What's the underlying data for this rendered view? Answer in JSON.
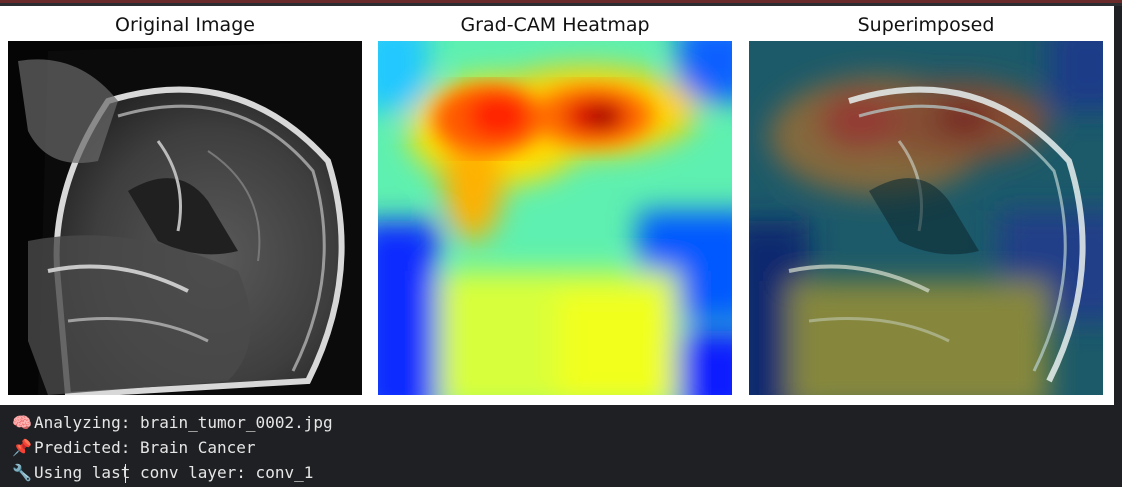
{
  "figure": {
    "titles": [
      "Original Image",
      "Grad-CAM Heatmap",
      "Superimposed"
    ]
  },
  "output": {
    "lines": [
      {
        "icon": "brain-icon",
        "glyph": "🧠",
        "text": "Analyzing: brain_tumor_0002.jpg"
      },
      {
        "icon": "pushpin-icon",
        "glyph": "📌",
        "text": "Predicted: Brain Cancer"
      },
      {
        "icon": "wrench-icon",
        "glyph": "🔧",
        "text": "Using last conv layer: conv_1"
      }
    ]
  },
  "colors": {
    "background": "#1f2023",
    "figure_bg": "#ffffff",
    "text": "#e6e6e6",
    "jet_low": "#00008f",
    "jet_mid": "#7fff7f",
    "jet_high": "#7f0000"
  }
}
